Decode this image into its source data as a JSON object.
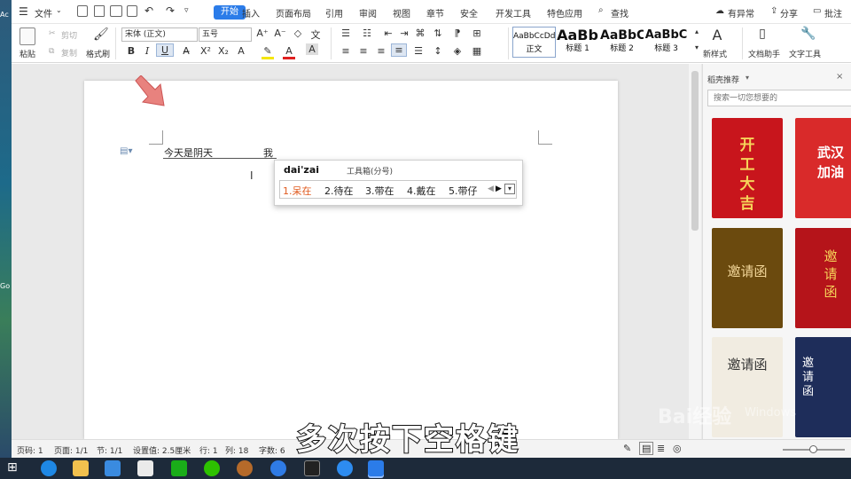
{
  "menu": {
    "file": "文件",
    "tabs": [
      "开始",
      "插入",
      "页面布局",
      "引用",
      "审阅",
      "视图",
      "章节",
      "安全",
      "开发工具",
      "特色应用"
    ],
    "search": "查找",
    "right": [
      "有异常",
      "分享",
      "批注"
    ]
  },
  "ribbon": {
    "paste": "粘贴",
    "cut": "剪切",
    "copy": "复制",
    "format_painter": "格式刷",
    "font_name": "宋体 (正文)",
    "font_size": "五号",
    "styles": [
      {
        "sample": "AaBbCcDd",
        "label": "正文"
      },
      {
        "sample": "AaBb",
        "label": "标题 1"
      },
      {
        "sample": "AaBbC",
        "label": "标题 2"
      },
      {
        "sample": "AaBbC",
        "label": "标题 3"
      }
    ],
    "new_style": "新样式",
    "doc_assistant": "文档助手",
    "text_tools": "文字工具"
  },
  "document": {
    "text": "今天是阴天",
    "ime_char": "我"
  },
  "ime": {
    "pinyin": "dai'zai",
    "toolbox": "工具箱(分号)",
    "candidates": [
      "1.呆在",
      "2.待在",
      "3.带在",
      "4.戴在",
      "5.带仔"
    ]
  },
  "panel": {
    "title": "稻壳推荐",
    "search_placeholder": "搜索一切您想要的",
    "cards": [
      {
        "text": "开工大吉",
        "bg": "#c8151c"
      },
      {
        "text": "武汉加油",
        "bg": "#d92a2a"
      },
      {
        "text": "邀请函",
        "bg": "#6b4a0e"
      },
      {
        "text": "邀请函",
        "bg": "#b5141a"
      },
      {
        "text": "邀请函",
        "bg": "#f1ece1"
      },
      {
        "text": "邀请函",
        "bg": "#1e2d5a"
      }
    ]
  },
  "status": {
    "items": [
      "页码: 1",
      "页面: 1/1",
      "节: 1/1",
      "设置值: 2.5厘米",
      "行: 1",
      "列: 18",
      "字数: 6"
    ]
  },
  "subtitle": "多次按下空格键",
  "watermark": "Bai经验",
  "watermark2": "Windows",
  "desktop_labels": [
    "Ac",
    "Go"
  ],
  "colors": {
    "accent": "#2b7ce9",
    "arrow": "#e8827e",
    "ime_selected": "#e05a1e"
  }
}
